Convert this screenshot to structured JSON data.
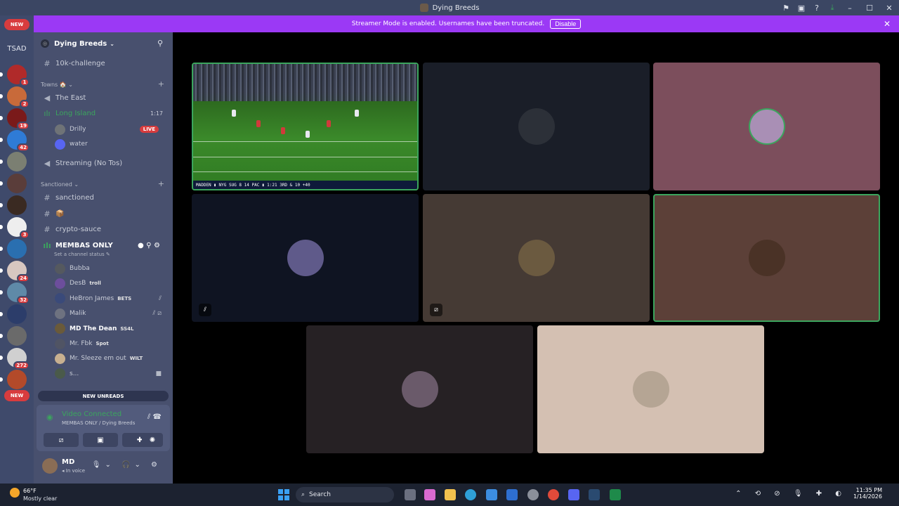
{
  "window": {
    "title": "Dying Breeds"
  },
  "banner": {
    "text": "Streamer Mode is enabled. Usernames have been truncated.",
    "disable_label": "Disable"
  },
  "rail": {
    "new_top": "NEW",
    "new_bottom": "NEW",
    "tsad": "TSAD",
    "servers": [
      {
        "badge": "1",
        "color": "#b02a2a"
      },
      {
        "badge": "2",
        "color": "#c86a3a"
      },
      {
        "badge": "19",
        "color": "#7a1a1a"
      },
      {
        "badge": "42",
        "color": "#2f7bd6"
      },
      {
        "badge": "",
        "color": "#7b7f72"
      },
      {
        "badge": "",
        "color": "#5a3d3a"
      },
      {
        "badge": "",
        "color": "#3a2a22"
      },
      {
        "badge": "3",
        "color": "#eeeeee"
      },
      {
        "badge": "",
        "color": "#2a6fb0"
      },
      {
        "badge": "24",
        "color": "#d7c7c0"
      },
      {
        "badge": "32",
        "color": "#5f8aa8"
      },
      {
        "badge": "",
        "color": "#2c3d6a"
      },
      {
        "badge": "",
        "color": "#6a6a6a"
      },
      {
        "badge": "272",
        "color": "#d0d0d0"
      },
      {
        "badge": "",
        "color": "#b34a2a"
      }
    ]
  },
  "sidebar": {
    "server_name": "Dying Breeds",
    "channels": {
      "challenge": "10k-challenge",
      "towns_category": "Towns 🏠",
      "the_east": "The East",
      "long_island": "Long Island",
      "long_island_timer": "1:17",
      "drilly": "Drilly",
      "live": "LIVE",
      "water": "water",
      "streaming": "Streaming (No Tos)",
      "sanctioned_category": "Sanctioned",
      "sanctioned": "sanctioned",
      "box": "📦",
      "crypto": "crypto-sauce",
      "membas": "MEMBAS ONLY",
      "set_status": "Set a channel status"
    },
    "members": [
      {
        "name": "Bubba",
        "tag": ""
      },
      {
        "name": "DesB",
        "tag": "troll"
      },
      {
        "name": "HeBron James",
        "tag": "BETS"
      },
      {
        "name": "Malik",
        "tag": ""
      },
      {
        "name": "MD The Dean",
        "tag": "SS4L"
      },
      {
        "name": "Mr. Fbk",
        "tag": "Spot"
      },
      {
        "name": "Mr. Sleeze em out",
        "tag": "WILT"
      },
      {
        "name": "s...",
        "tag": ""
      }
    ],
    "new_unreads": "NEW UNREADS"
  },
  "voice": {
    "status": "Video Connected",
    "location": "MEMBAS ONLY / Dying Breeds"
  },
  "user": {
    "name": "MD",
    "status": "In voice"
  },
  "stream": {
    "scorebar": "MADDEN  ▮ NYG  SUG  8  14  PAC  ▮  1:21  3RD & 10  +40"
  },
  "taskbar": {
    "weather_temp": "66°F",
    "weather_desc": "Mostly clear",
    "search": "Search",
    "time": "11:35 PM",
    "date": "1/14/2026"
  },
  "colors": {
    "accent_green": "#3ba55d",
    "banner_purple": "#9b39f5",
    "danger_red": "#d83c3e"
  }
}
